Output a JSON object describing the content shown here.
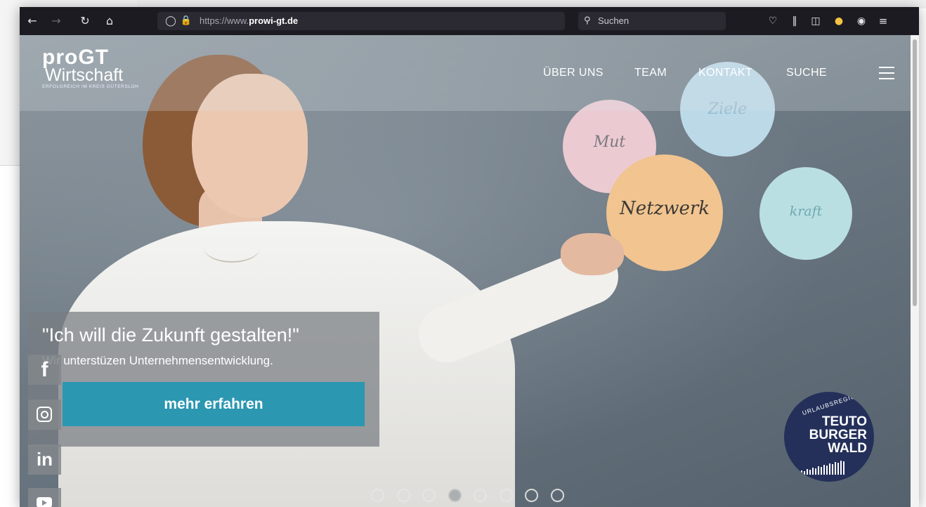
{
  "browser": {
    "url_prefix": "https://www.",
    "url_domain": "prowi-gt.de",
    "search_placeholder": "Suchen",
    "icons": [
      "back-icon",
      "forward-icon",
      "reload-icon",
      "home-icon",
      "shield-icon",
      "lock-icon",
      "star-icon",
      "search-icon",
      "pocket-icon",
      "library-icon",
      "sidebar-icon",
      "extension-icon",
      "account-icon",
      "menu-icon"
    ]
  },
  "site": {
    "logo": {
      "line1": "proGT",
      "line2": "Wirtschaft",
      "tagline": "ERFOLGREICH IM KREIS GÜTERSLOH"
    },
    "nav": [
      "ÜBER UNS",
      "TEAM",
      "KONTAKT",
      "SUCHE"
    ],
    "circles": [
      "Mut",
      "Ziele",
      "Netzwerk",
      "kraft"
    ],
    "hero": {
      "title": "\"Ich will die Zukunft gestalten!\"",
      "subtitle": "Wir unterstüzen Unternehmensentwicklung.",
      "button": "mehr erfahren"
    },
    "social": [
      "f",
      "instagram",
      "in",
      "youtube"
    ],
    "badge": {
      "region": "URLAUBSREGION",
      "l1": "TEUTO",
      "l2": "BURGER",
      "l3": "WALD"
    },
    "slider": {
      "count": 8,
      "active": 4
    }
  },
  "colors": {
    "button": "#2b97b1",
    "badge": "#24305a",
    "browser": "#1c1b22"
  }
}
